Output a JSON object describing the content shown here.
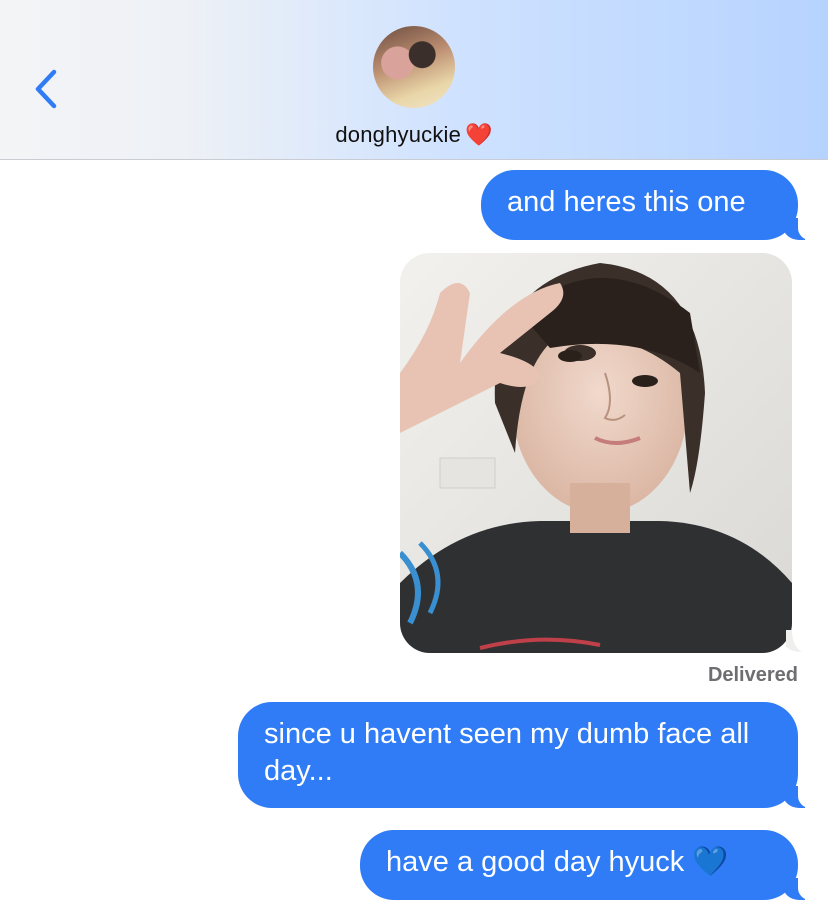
{
  "header": {
    "back_icon": "chevron-left-icon",
    "contact_name": "donghyuckie",
    "contact_emoji": "❤️",
    "accent_color": "#2f7cf6"
  },
  "messages": [
    {
      "type": "text",
      "direction": "outgoing",
      "text": "and heres this one"
    },
    {
      "type": "image",
      "direction": "outgoing",
      "description": "selfie photo"
    },
    {
      "type": "text",
      "direction": "outgoing",
      "text": "since u havent seen my dumb face all day..."
    },
    {
      "type": "text",
      "direction": "outgoing",
      "text": "have a good day hyuck 💙"
    }
  ],
  "status": {
    "delivered_label": "Delivered"
  }
}
